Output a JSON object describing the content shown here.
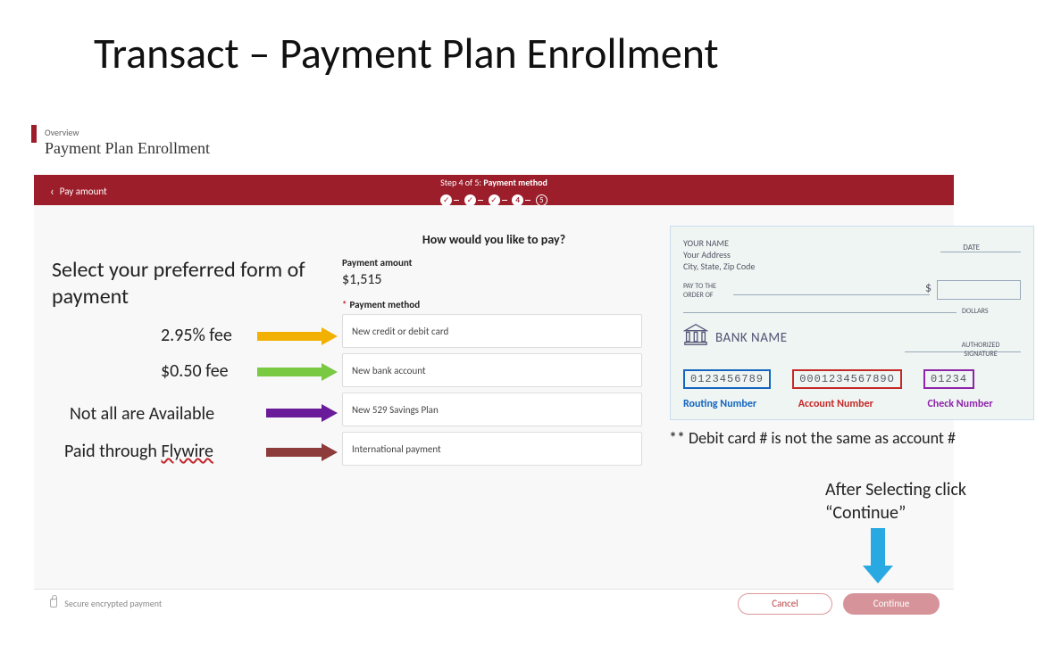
{
  "slide_title": "Transact – Payment Plan Enrollment",
  "breadcrumb": "Overview",
  "page_title": "Payment Plan Enrollment",
  "back_link": "Pay amount",
  "step_label_prefix": "Step 4 of 5:",
  "step_label_current": "Payment method",
  "step_current_num": "4",
  "step_future_num": "5",
  "prompt": "How would you like to pay?",
  "amount_label": "Payment amount",
  "amount_value": "$1,515",
  "method_label": "Payment method",
  "options": {
    "credit": "New credit or debit card",
    "bank": "New bank account",
    "savings529": "New 529 Savings Plan",
    "intl": "International payment"
  },
  "secure_text": "Secure encrypted payment",
  "buttons": {
    "cancel": "Cancel",
    "continue": "Continue"
  },
  "annotations": {
    "instruct": "Select your preferred form of payment",
    "fee1": "2.95% fee",
    "fee2": "$0.50 fee",
    "fee3": "Not all are Available",
    "fee4_pre": "Paid through ",
    "fee4_underlined": "Flywire",
    "debit_note": "** Debit card # is not the same as account #",
    "after_note": "After Selecting click “Continue”"
  },
  "check": {
    "your_name": "YOUR NAME",
    "your_addr": "Your Address",
    "city": "City, State, Zip Code",
    "date": "DATE",
    "payto": "PAY TO THE",
    "orderof": "ORDER OF",
    "dollars": "DOLLARS",
    "bank": "BANK NAME",
    "auth": "AUTHORIZED",
    "sig": "SIGNATURE",
    "routing": "0123456789",
    "account": "000123456789O",
    "checknum": "01234",
    "l_routing": "Routing Number",
    "l_account": "Account Number",
    "l_check": "Check Number"
  }
}
